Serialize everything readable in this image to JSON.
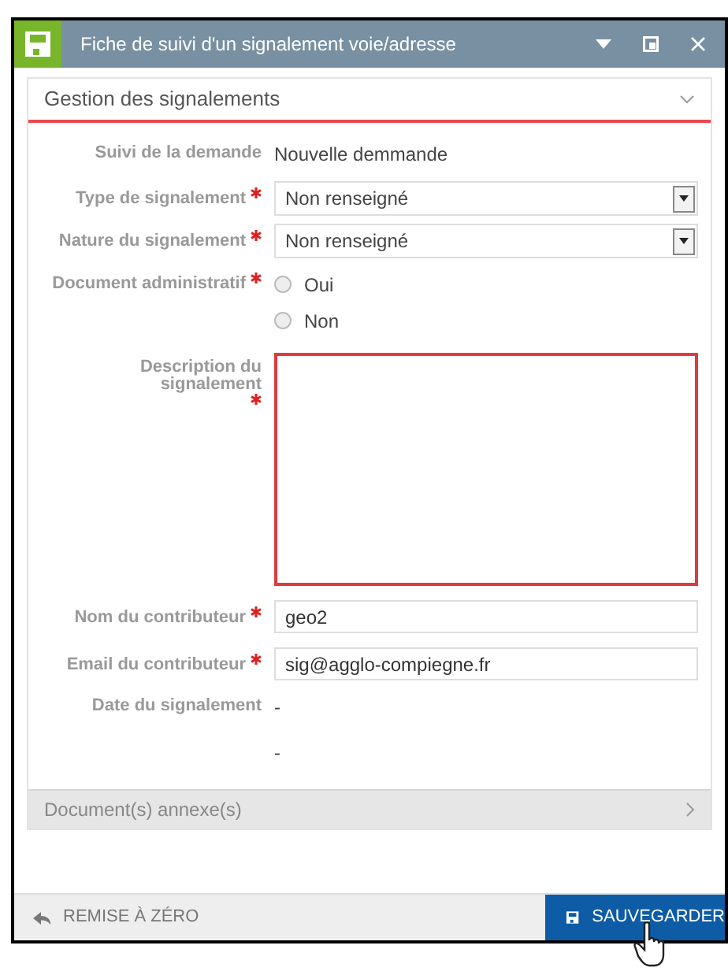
{
  "window": {
    "title": "Fiche de suivi d'un signalement voie/adresse"
  },
  "section": {
    "title": "Gestion des signalements",
    "expanded": true
  },
  "fields": [
    {
      "kind": "static",
      "label": "Suivi de la demande",
      "required": false,
      "value": "Nouvelle demmande"
    },
    {
      "kind": "select",
      "label": "Type de signalement",
      "required": true,
      "value": "Non renseigné"
    },
    {
      "kind": "select",
      "label": "Nature du signalement",
      "required": true,
      "value": "Non renseigné"
    },
    {
      "kind": "radio",
      "label": "Document administratif",
      "required": true,
      "options": [
        {
          "label": "Oui",
          "selected": false
        },
        {
          "label": "Non",
          "selected": false
        }
      ]
    },
    {
      "kind": "textarea",
      "label": "Description du signalement",
      "required": true,
      "invalid": true
    },
    {
      "kind": "text",
      "label": "Nom du contributeur",
      "required": true,
      "value": "geo2"
    },
    {
      "kind": "text",
      "label": "Email du contributeur",
      "required": true,
      "value": "sig@agglo-compiegne.fr"
    },
    {
      "kind": "static",
      "label": "Date du signalement",
      "required": false,
      "value": "-"
    },
    {
      "kind": "static",
      "required": false,
      "value": "-"
    }
  ],
  "collapsed_section": {
    "title": "Document(s) annexe(s)",
    "expanded": false
  },
  "footer": {
    "reset": "REMISE À ZÉRO",
    "save": "SAUVEGARDER"
  }
}
